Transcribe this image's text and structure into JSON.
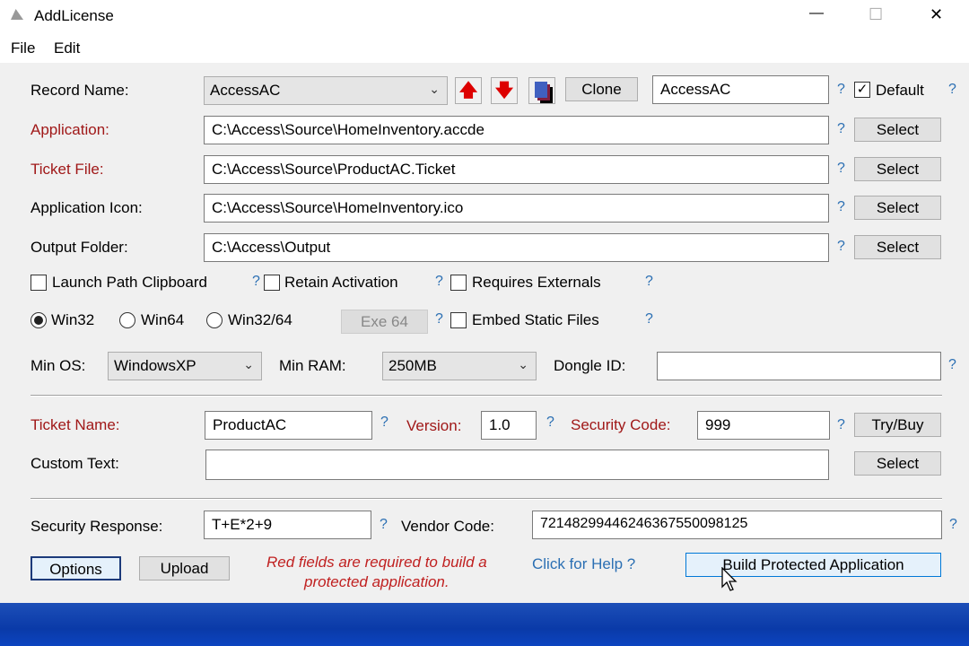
{
  "window": {
    "title": "AddLicense",
    "minimize": "—",
    "maximize": "☐",
    "close": "✕"
  },
  "menu": [
    "File",
    "Edit"
  ],
  "record": {
    "label": "Record Name:",
    "value": "AccessAC",
    "clone": "Clone",
    "name": "AccessAC",
    "default_label": "Default",
    "default_checked": true
  },
  "paths": [
    {
      "label": "Application:",
      "value": "C:\\Access\\Source\\HomeInventory.accde",
      "required": true,
      "button": "Select"
    },
    {
      "label": "Ticket File:",
      "value": "C:\\Access\\Source\\ProductAC.Ticket",
      "required": true,
      "button": "Select"
    },
    {
      "label": "Application Icon:",
      "value": "C:\\Access\\Source\\HomeInventory.ico",
      "required": false,
      "button": "Select"
    },
    {
      "label": "Output Folder:",
      "value": "C:\\Access\\Output",
      "required": false,
      "button": "Select"
    }
  ],
  "checks": {
    "launch": "Launch Path Clipboard",
    "retain": "Retain Activation",
    "externals": "Requires Externals",
    "embed": "Embed Static Files"
  },
  "platform": {
    "options": [
      "Win32",
      "Win64",
      "Win32/64"
    ],
    "selected": "Win32",
    "exe64": "Exe 64"
  },
  "minos": {
    "label": "Min OS:",
    "value": "WindowsXP"
  },
  "minram": {
    "label": "Min RAM:",
    "value": "250MB"
  },
  "dongle": {
    "label": "Dongle ID:",
    "value": ""
  },
  "ticket": {
    "name_label": "Ticket Name:",
    "name": "ProductAC",
    "version_label": "Version:",
    "version": "1.0",
    "code_label": "Security Code:",
    "code": "999",
    "trybuy": "Try/Buy"
  },
  "custom": {
    "label": "Custom Text:",
    "value": "",
    "button": "Select"
  },
  "security": {
    "label": "Security Response:",
    "value": "T+E*2+9",
    "vendor_label": "Vendor Code:",
    "vendor": "72148299446246367550098125"
  },
  "footer": {
    "options": "Options",
    "upload": "Upload",
    "note1": "Red fields are required to build a",
    "note2": "protected application.",
    "help": "Click for Help ?",
    "build": "Build Protected Application"
  },
  "q": "?"
}
